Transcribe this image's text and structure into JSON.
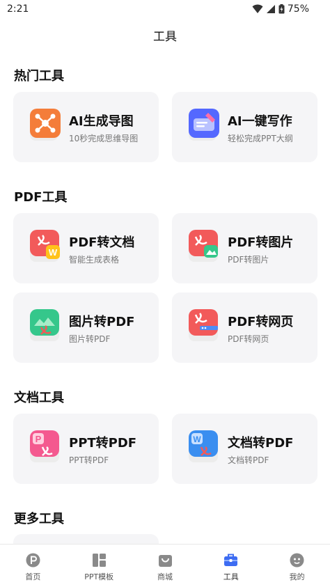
{
  "status_bar": {
    "time": "2:21",
    "battery": "75%"
  },
  "header": {
    "title": "工具"
  },
  "sections": [
    {
      "title": "热门工具",
      "items": [
        {
          "name": "AI生成导图",
          "desc": "10秒完成思维导图",
          "icon": "mindmap-icon"
        },
        {
          "name": "AI一键写作",
          "desc": "轻松完成PPT大纲",
          "icon": "ai-writing-icon"
        }
      ]
    },
    {
      "title": "PDF工具",
      "items": [
        {
          "name": "PDF转文档",
          "desc": "智能生成表格",
          "icon": "pdf-to-word-icon"
        },
        {
          "name": "PDF转图片",
          "desc": "PDF转图片",
          "icon": "pdf-to-image-icon"
        },
        {
          "name": "图片转PDF",
          "desc": "图片转PDF",
          "icon": "image-to-pdf-icon"
        },
        {
          "name": "PDF转网页",
          "desc": "PDF转网页",
          "icon": "pdf-to-web-icon"
        }
      ]
    },
    {
      "title": "文档工具",
      "items": [
        {
          "name": "PPT转PDF",
          "desc": "PPT转PDF",
          "icon": "ppt-to-pdf-icon"
        },
        {
          "name": "文档转PDF",
          "desc": "文档转PDF",
          "icon": "word-to-pdf-icon"
        }
      ]
    },
    {
      "title": "更多工具",
      "items": []
    }
  ],
  "tab_bar": {
    "items": [
      {
        "label": "首页",
        "icon": "home-icon",
        "active": false
      },
      {
        "label": "PPT模板",
        "icon": "template-icon",
        "active": false
      },
      {
        "label": "商城",
        "icon": "shop-bag-icon",
        "active": false
      },
      {
        "label": "工具",
        "icon": "toolbox-icon",
        "active": true
      },
      {
        "label": "我的",
        "icon": "profile-icon",
        "active": false
      }
    ]
  },
  "colors": {
    "card_bg": "#f5f5f7",
    "mindmap_orange": "#f47d3a",
    "ai_write_blue": "#5468ff",
    "pdf_red": "#f25a5a",
    "word_yellow": "#ffc21a",
    "image_green": "#35c78b",
    "web_blue": "#4d8cf5",
    "ppt_pink": "#f4598f",
    "word_blue": "#3a8ef0",
    "tab_active": "#3d6cf2",
    "tab_inactive": "#888888"
  }
}
